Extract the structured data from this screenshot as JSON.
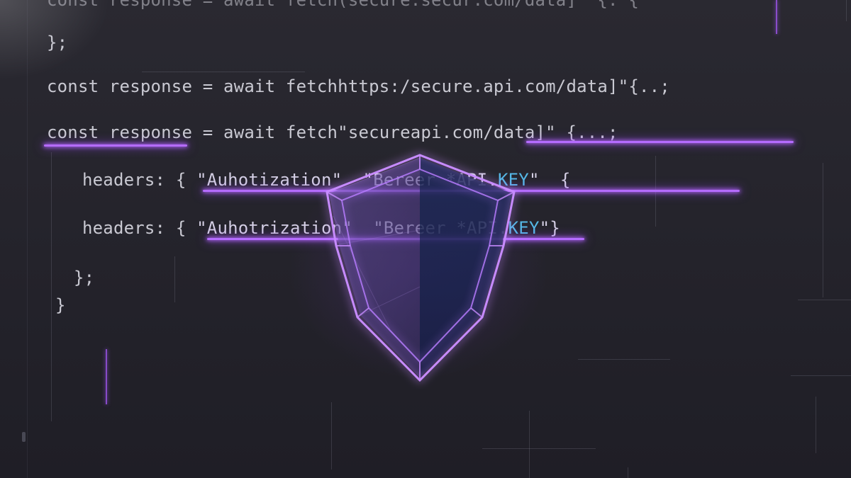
{
  "code": {
    "line0_a": "const response = await fetch(secure.secur.com/data]\" {. {",
    "line1": "};",
    "line2": "const response = await fetchhttps:/secure.api.com/data]\"{..;",
    "line3_a": "const response",
    "line3_b": " = await fetch\"secureapi.com/data]\" {...;",
    "line4_a": "headers: { ",
    "line4_b": "\"Auhotization\"  \"Bereer *API.",
    "line4_key": "KEY",
    "line4_c": "\"  {",
    "line5_a": "headers: { ",
    "line5_b": "\"Auhotrization\"  \"Bereer *API.",
    "line5_key": "KEY",
    "line5_c": "\"}",
    "line6": "};",
    "line7": "}"
  },
  "shield": {
    "icon": "shield-icon",
    "glow_color": "#b56cff"
  },
  "colors": {
    "background": "#24232c",
    "text": "#c9c9d2",
    "accent": "#b56cff",
    "key": "#55b8e6"
  }
}
